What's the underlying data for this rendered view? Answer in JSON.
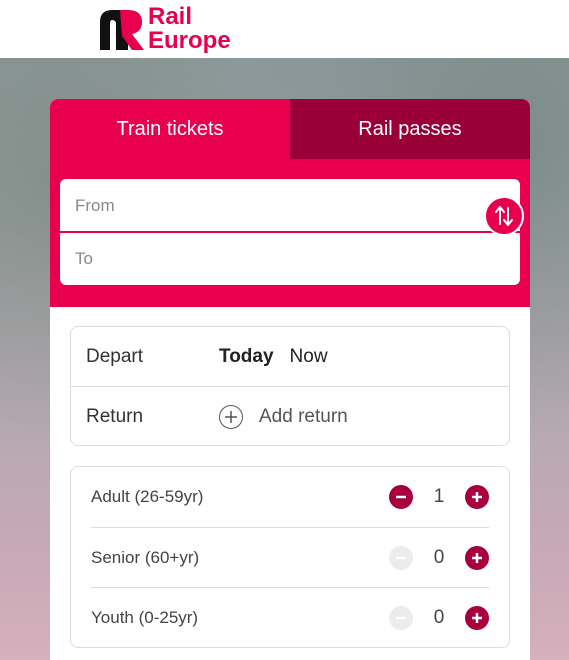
{
  "brand": {
    "line1": "Rail",
    "line2": "Europe",
    "color": "#e8004f"
  },
  "tabs": [
    {
      "label": "Train tickets",
      "active": true
    },
    {
      "label": "Rail passes",
      "active": false
    }
  ],
  "route": {
    "from_placeholder": "From",
    "to_placeholder": "To",
    "swap_icon": "swap-vertical-icon"
  },
  "dates": {
    "depart_label": "Depart",
    "depart_day": "Today",
    "depart_time": "Now",
    "return_label": "Return",
    "add_return_label": "Add return"
  },
  "passengers": [
    {
      "label": "Adult (26-59yr)",
      "count": "1",
      "minus_enabled": true
    },
    {
      "label": "Senior (60+yr)",
      "count": "0",
      "minus_enabled": false
    },
    {
      "label": "Youth (0-25yr)",
      "count": "0",
      "minus_enabled": false
    }
  ],
  "colors": {
    "accent": "#e8004f",
    "accent_dark": "#9a0036",
    "button": "#a8003e"
  }
}
